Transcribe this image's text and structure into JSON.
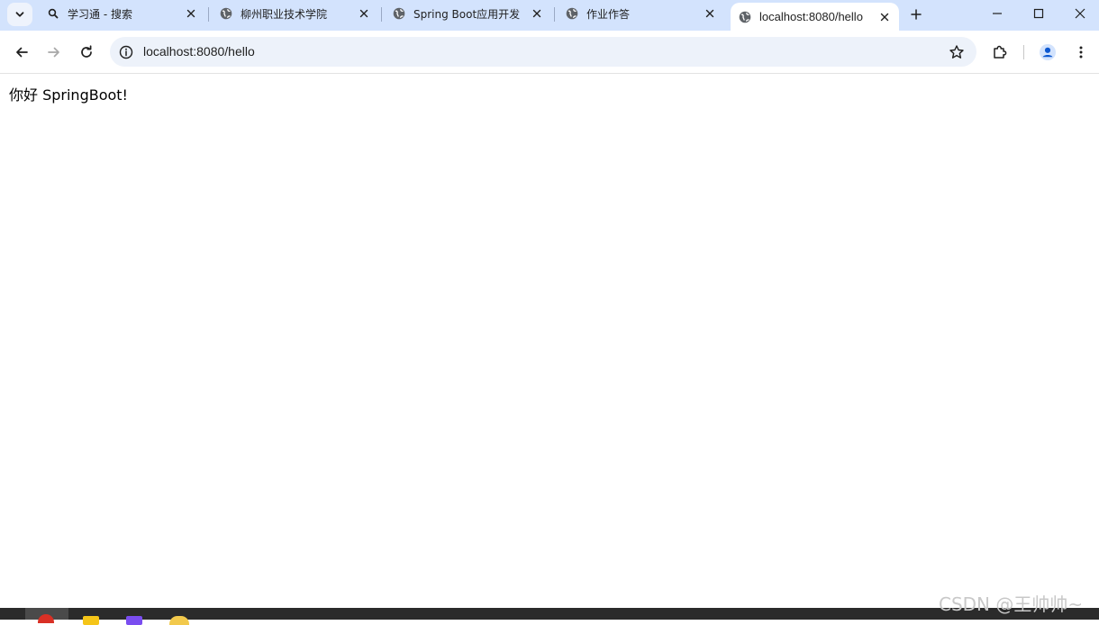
{
  "browser": {
    "tabs": [
      {
        "title": "学习通 - 搜索",
        "icon": "search-icon"
      },
      {
        "title": "柳州职业技术学院",
        "icon": "globe-icon"
      },
      {
        "title": "Spring Boot应用开发",
        "icon": "globe-icon"
      },
      {
        "title": "作业作答",
        "icon": "globe-icon"
      },
      {
        "title": "localhost:8080/hello",
        "icon": "globe-icon",
        "active": true
      }
    ],
    "address": "localhost:8080/hello"
  },
  "page": {
    "text": "你好 SpringBoot!"
  },
  "watermark": "CSDN @王帅帅~",
  "colors": {
    "tabstrip": "#d3e3fd",
    "omnibox": "#edf2fa",
    "profile": "#0b57d0"
  }
}
